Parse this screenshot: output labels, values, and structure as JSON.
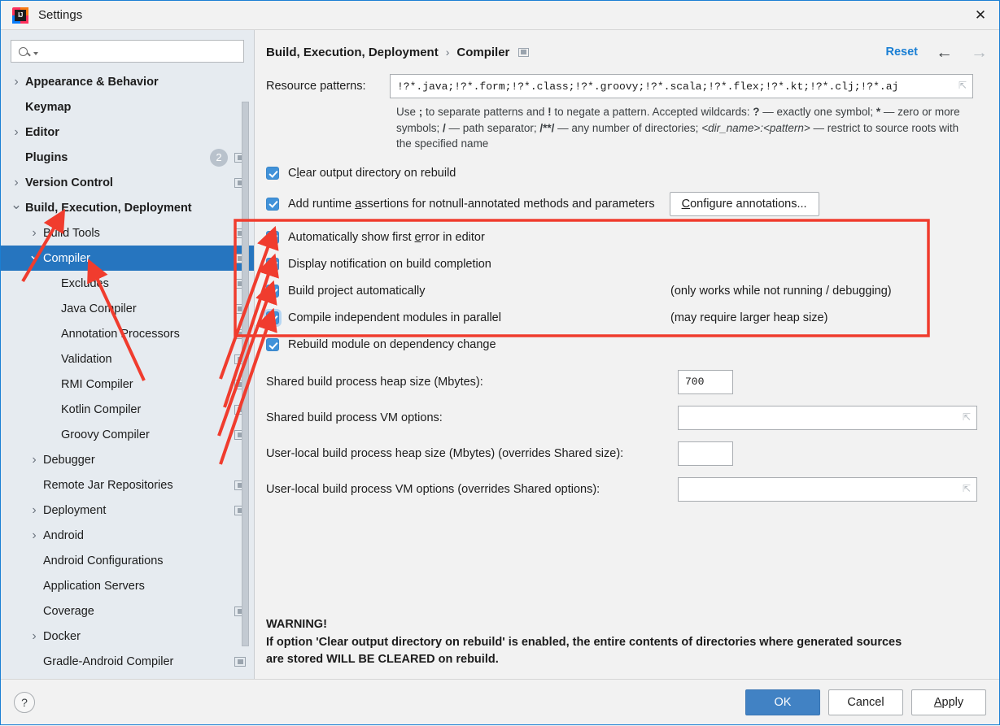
{
  "window": {
    "title": "Settings",
    "close_icon": "close-icon",
    "logo_text": "IJ"
  },
  "sidebar": {
    "search": {
      "placeholder": "",
      "value": "",
      "icon": "search-icon"
    },
    "items": [
      {
        "label": "Appearance & Behavior",
        "arrow": "›",
        "bold": true,
        "indent": 0,
        "selected": false,
        "badge": "",
        "proj_icon": false
      },
      {
        "label": "Keymap",
        "arrow": "",
        "bold": true,
        "indent": 0,
        "selected": false,
        "badge": "",
        "proj_icon": false
      },
      {
        "label": "Editor",
        "arrow": "›",
        "bold": true,
        "indent": 0,
        "selected": false,
        "badge": "",
        "proj_icon": false
      },
      {
        "label": "Plugins",
        "arrow": "",
        "bold": true,
        "indent": 0,
        "selected": false,
        "badge": "2",
        "proj_icon": true
      },
      {
        "label": "Version Control",
        "arrow": "›",
        "bold": true,
        "indent": 0,
        "selected": false,
        "badge": "",
        "proj_icon": true
      },
      {
        "label": "Build, Execution, Deployment",
        "arrow": "⌄",
        "bold": true,
        "indent": 0,
        "selected": false,
        "badge": "",
        "proj_icon": false
      },
      {
        "label": "Build Tools",
        "arrow": "›",
        "bold": false,
        "indent": 1,
        "selected": false,
        "badge": "",
        "proj_icon": true
      },
      {
        "label": "Compiler",
        "arrow": "⌄",
        "bold": false,
        "indent": 1,
        "selected": true,
        "badge": "",
        "proj_icon": true
      },
      {
        "label": "Excludes",
        "arrow": "",
        "bold": false,
        "indent": 2,
        "selected": false,
        "badge": "",
        "proj_icon": true
      },
      {
        "label": "Java Compiler",
        "arrow": "",
        "bold": false,
        "indent": 2,
        "selected": false,
        "badge": "",
        "proj_icon": true
      },
      {
        "label": "Annotation Processors",
        "arrow": "",
        "bold": false,
        "indent": 2,
        "selected": false,
        "badge": "",
        "proj_icon": true
      },
      {
        "label": "Validation",
        "arrow": "",
        "bold": false,
        "indent": 2,
        "selected": false,
        "badge": "",
        "proj_icon": true
      },
      {
        "label": "RMI Compiler",
        "arrow": "",
        "bold": false,
        "indent": 2,
        "selected": false,
        "badge": "",
        "proj_icon": true
      },
      {
        "label": "Kotlin Compiler",
        "arrow": "",
        "bold": false,
        "indent": 2,
        "selected": false,
        "badge": "",
        "proj_icon": true
      },
      {
        "label": "Groovy Compiler",
        "arrow": "",
        "bold": false,
        "indent": 2,
        "selected": false,
        "badge": "",
        "proj_icon": true
      },
      {
        "label": "Debugger",
        "arrow": "›",
        "bold": false,
        "indent": 1,
        "selected": false,
        "badge": "",
        "proj_icon": false
      },
      {
        "label": "Remote Jar Repositories",
        "arrow": "",
        "bold": false,
        "indent": 1,
        "selected": false,
        "badge": "",
        "proj_icon": true
      },
      {
        "label": "Deployment",
        "arrow": "›",
        "bold": false,
        "indent": 1,
        "selected": false,
        "badge": "",
        "proj_icon": true
      },
      {
        "label": "Android",
        "arrow": "›",
        "bold": false,
        "indent": 1,
        "selected": false,
        "badge": "",
        "proj_icon": false
      },
      {
        "label": "Android Configurations",
        "arrow": "",
        "bold": false,
        "indent": 1,
        "selected": false,
        "badge": "",
        "proj_icon": false
      },
      {
        "label": "Application Servers",
        "arrow": "",
        "bold": false,
        "indent": 1,
        "selected": false,
        "badge": "",
        "proj_icon": false
      },
      {
        "label": "Coverage",
        "arrow": "",
        "bold": false,
        "indent": 1,
        "selected": false,
        "badge": "",
        "proj_icon": true
      },
      {
        "label": "Docker",
        "arrow": "›",
        "bold": false,
        "indent": 1,
        "selected": false,
        "badge": "",
        "proj_icon": false
      },
      {
        "label": "Gradle-Android Compiler",
        "arrow": "",
        "bold": false,
        "indent": 1,
        "selected": false,
        "badge": "",
        "proj_icon": true
      }
    ]
  },
  "header": {
    "breadcrumb_root": "Build, Execution, Deployment",
    "breadcrumb_sep": "›",
    "breadcrumb_leaf": "Compiler",
    "reset_label": "Reset",
    "back_icon": "←",
    "forward_icon": "→"
  },
  "main": {
    "resource_patterns_label": "Resource patterns:",
    "resource_patterns_value": "!?*.java;!?*.form;!?*.class;!?*.groovy;!?*.scala;!?*.flex;!?*.kt;!?*.clj;!?*.aj",
    "hint_line1_a": "Use ",
    "hint_semicolon": ";",
    "hint_line1_b": " to separate patterns and ",
    "hint_bang": "!",
    "hint_line1_c": " to negate a pattern. Accepted wildcards: ",
    "hint_q": "?",
    "hint_line1_d": " — exactly one symbol; ",
    "hint_star": "*",
    "hint_line1_e": " — zero or more symbols; ",
    "hint_slash": "/",
    "hint_line1_f": " — path separator; ",
    "hint_starstar": "/**/",
    "hint_line1_g": " — any number of directories; ",
    "hint_dirname": "<dir_name>:<pattern>",
    "hint_line1_h": " — restrict to source roots with the specified name",
    "checkboxes": [
      {
        "label_pre": "C",
        "mnemonic": "l",
        "label_post": "ear output directory on rebuild",
        "checked": true,
        "focused": false,
        "note": ""
      },
      {
        "label_pre": "Add runtime ",
        "mnemonic": "a",
        "label_post": "ssertions for notnull-annotated methods and parameters",
        "checked": true,
        "focused": false,
        "note": ""
      },
      {
        "label_pre": "Automatically show first ",
        "mnemonic": "e",
        "label_post": "rror in editor",
        "checked": true,
        "focused": false,
        "note": ""
      },
      {
        "label_pre": "Display notification on build completion",
        "mnemonic": "",
        "label_post": "",
        "checked": true,
        "focused": false,
        "note": ""
      },
      {
        "label_pre": "Build project automatically",
        "mnemonic": "",
        "label_post": "",
        "checked": true,
        "focused": false,
        "note": "(only works while not running / debugging)"
      },
      {
        "label_pre": "Compile independent modules in parallel",
        "mnemonic": "",
        "label_post": "",
        "checked": true,
        "focused": true,
        "note": "(may require larger heap size)"
      },
      {
        "label_pre": "Rebuild module on dependency change",
        "mnemonic": "",
        "label_post": "",
        "checked": true,
        "focused": false,
        "note": ""
      }
    ],
    "configure_annotations_pre": "",
    "configure_annotations_mnemonic": "C",
    "configure_annotations_post": "onfigure annotations...",
    "fields": [
      {
        "label": "Shared build process heap size (Mbytes):",
        "value": "700",
        "wide": false
      },
      {
        "label": "Shared build process VM options:",
        "value": "",
        "wide": true
      },
      {
        "label": "User-local build process heap size (Mbytes) (overrides Shared size):",
        "value": "",
        "wide": false
      },
      {
        "label": "User-local build process VM options (overrides Shared options):",
        "value": "",
        "wide": true
      }
    ],
    "warning_title": "WARNING!",
    "warning_line1": "If option 'Clear output directory on rebuild' is enabled, the entire contents of directories where generated sources",
    "warning_line2": "are stored WILL BE CLEARED on rebuild."
  },
  "footer": {
    "help_label": "?",
    "ok_label": "OK",
    "cancel_label": "Cancel",
    "apply_mnemonic": "A",
    "apply_rest": "pply"
  },
  "annotation": {
    "color": "#f03c2e",
    "description": "red highlight rectangle around four checkbox options with arrows pointing to them and to sidebar tree nodes"
  }
}
